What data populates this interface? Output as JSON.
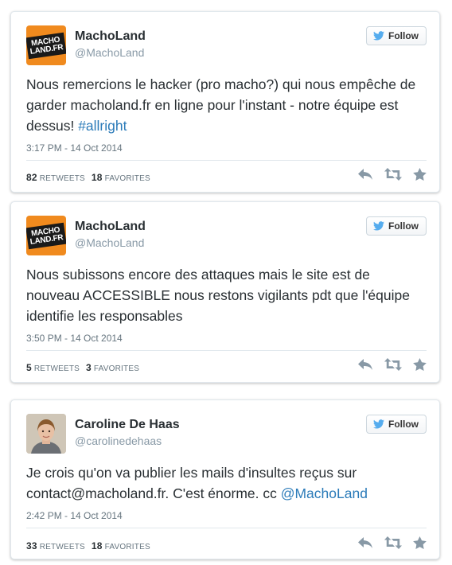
{
  "follow_label": "Follow",
  "colors": {
    "link": "#2b7bb9",
    "icon_grey": "#8899a6",
    "twitter_blue": "#55acee"
  },
  "tweets": [
    {
      "name": "MachoLand",
      "handle": "@MachoLand",
      "avatar": "macholand-logo",
      "logo_text": [
        "MACHO",
        "LAND.FR"
      ],
      "text": "Nous remercions le hacker (pro macho?) qui nous empêche de garder macholand.fr en ligne pour l'instant - notre équipe est dessus! ",
      "text_link": "#allright",
      "time": "3:17 PM - 14 Oct 2014",
      "retweets": "82",
      "retweets_label": "RETWEETS",
      "favorites": "18",
      "favorites_label": "FAVORITES"
    },
    {
      "name": "MachoLand",
      "handle": "@MachoLand",
      "avatar": "macholand-logo",
      "logo_text": [
        "MACHO",
        "LAND.FR"
      ],
      "text": "Nous subissons encore des attaques mais le site est de nouveau ACCESSIBLE nous restons vigilants pdt que l'équipe identifie les responsables",
      "text_link": "",
      "time": "3:50 PM - 14 Oct 2014",
      "retweets": "5",
      "retweets_label": "RETWEETS",
      "favorites": "3",
      "favorites_label": "FAVORITES"
    },
    {
      "name": "Caroline De Haas",
      "handle": "@carolinedehaas",
      "avatar": "user-photo",
      "text": "Je crois qu'on va publier les mails d'insultes reçus sur contact@macholand.fr. C'est énorme. cc ",
      "text_link": "@MachoLand",
      "time": "2:42 PM - 14 Oct 2014",
      "retweets": "33",
      "retweets_label": "RETWEETS",
      "favorites": "18",
      "favorites_label": "FAVORITES"
    }
  ]
}
